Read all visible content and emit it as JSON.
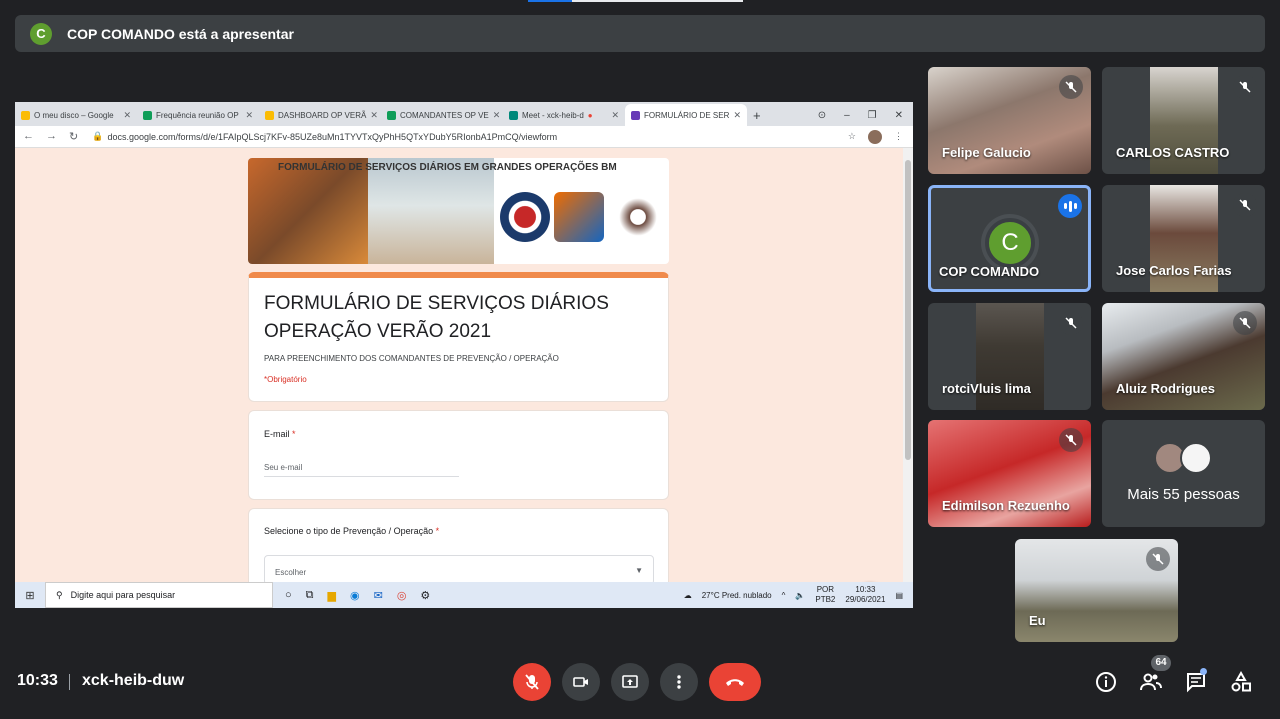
{
  "presentation_banner": {
    "avatar_letter": "C",
    "text": "COP COMANDO está a apresentar"
  },
  "shared_screen": {
    "browser": {
      "tabs": [
        {
          "label": "O meu disco – Google",
          "color": "#fbbc04"
        },
        {
          "label": "Frequência reunião OP",
          "color": "#0f9d58"
        },
        {
          "label": "DASHBOARD OP VERÃ",
          "color": "#fbbc04"
        },
        {
          "label": "COMANDANTES OP VE",
          "color": "#0f9d58"
        },
        {
          "label": "Meet - xck-heib-d",
          "color": "#00897b"
        },
        {
          "label": "FORMULÁRIO DE SER",
          "color": "#673ab7"
        }
      ],
      "new_tab": "+",
      "window_controls": [
        "⊙",
        "–",
        "❐",
        "✕"
      ],
      "address": "docs.google.com/forms/d/e/1FAIpQLScj7KFv-85UZe8uMn1TYVTxQyPhH5QTxYDubY5RIonbA1PmCQ/viewform",
      "nav": [
        "←",
        "→",
        "↻"
      ]
    },
    "form": {
      "banner_title": "FORMULÁRIO DE SERVIÇOS DIÁRIOS EM GRANDES OPERAÇÕES BM",
      "title": "FORMULÁRIO DE SERVIÇOS DIÁRIOS OPERAÇÃO VERÃO 2021",
      "description": "PARA PREENCHIMENTO DOS COMANDANTES DE PREVENÇÃO / OPERAÇÃO",
      "required_note": "*Obrigatório",
      "email_label": "E-mail",
      "email_placeholder": "Seu e-mail",
      "select_label": "Selecione o tipo de Prevenção / Operação",
      "select_value": "Escolher",
      "asterisk": "*"
    },
    "taskbar": {
      "search_placeholder": "Digite aqui para pesquisar",
      "weather": "27°C  Pred. nublado",
      "lang": "POR",
      "lang2": "PTB2",
      "time": "10:33",
      "date": "29/06/2021"
    }
  },
  "participants": [
    {
      "name": "Felipe Galucio",
      "muted": true
    },
    {
      "name": "CARLOS CASTRO",
      "muted": true
    },
    {
      "name": "COP COMANDO",
      "avatar_letter": "C",
      "speaking": true
    },
    {
      "name": "Jose Carlos Farias",
      "muted": true
    },
    {
      "name": "rotciVluis lima",
      "muted": true
    },
    {
      "name": "Aluiz Rodrigues",
      "muted": true
    },
    {
      "name": "Edimilson Rezuenho",
      "muted": true
    },
    {
      "name": "Mais 55 pessoas"
    },
    {
      "name": "Eu",
      "muted": true
    }
  ],
  "bottom_bar": {
    "time": "10:33",
    "meeting_code": "xck-heib-duw",
    "people_count": "64"
  },
  "colors": {
    "background": "#202124",
    "end_call": "#ea4335",
    "accent": "#1a73e8"
  }
}
